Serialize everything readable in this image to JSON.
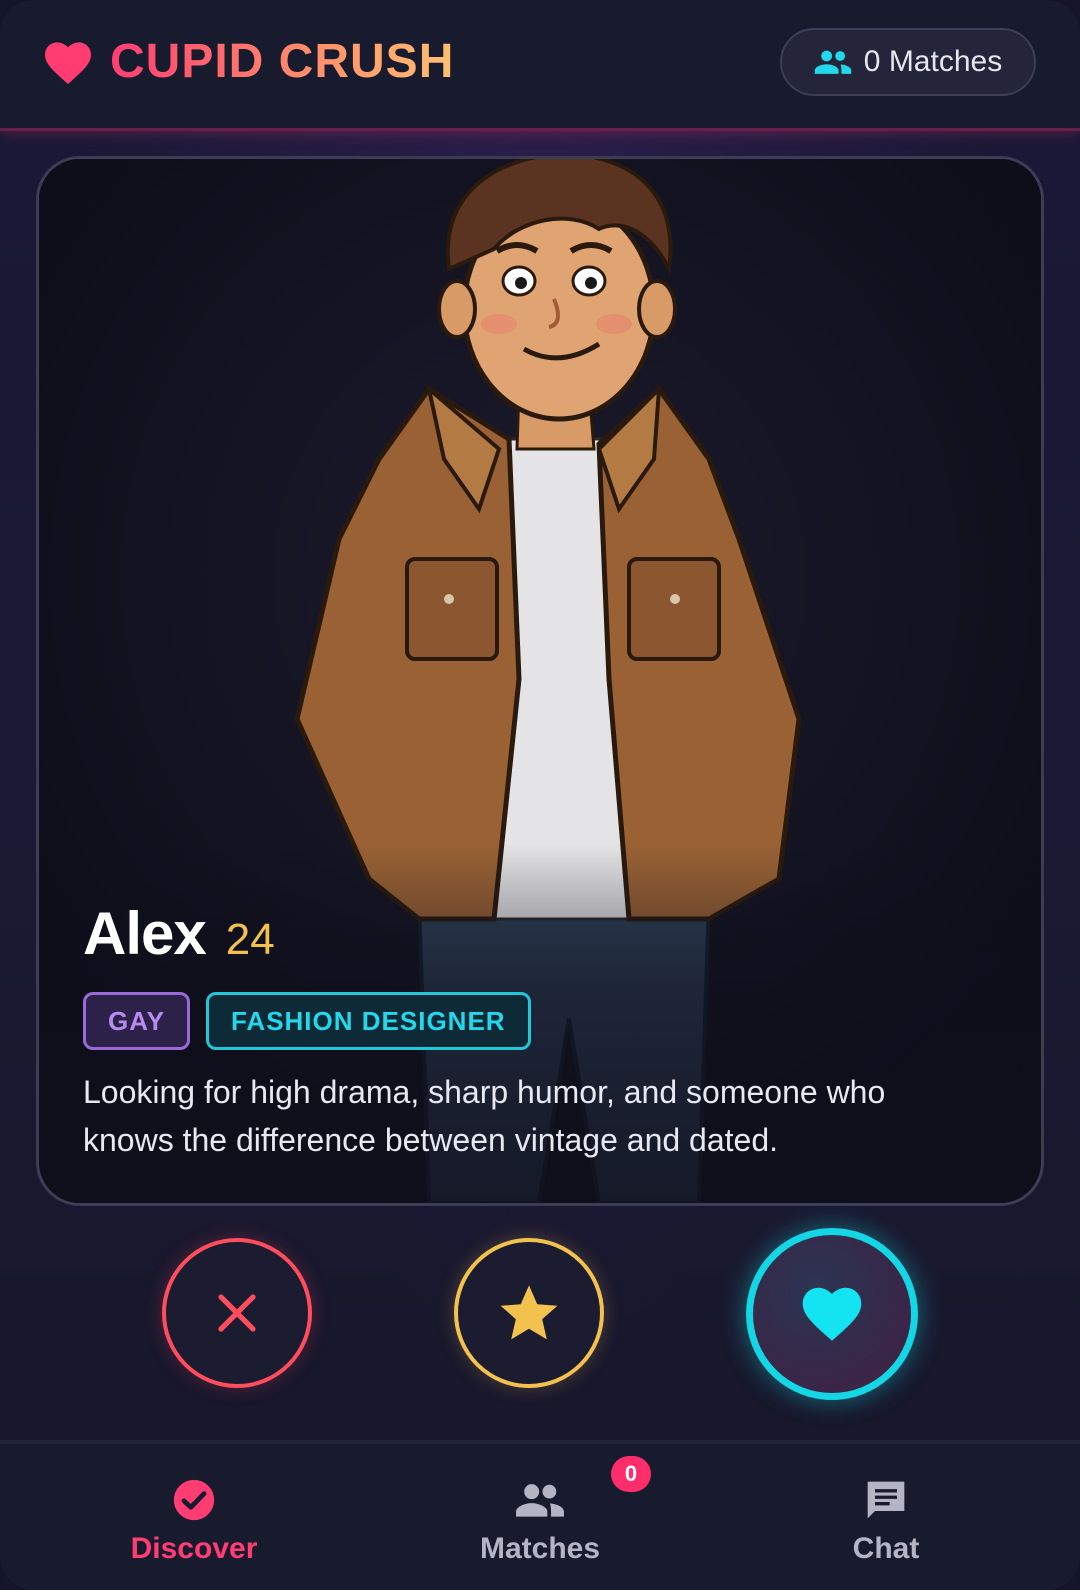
{
  "header": {
    "app_title": "CUPID CRUSH",
    "logo_icon": "heart-icon",
    "matches_pill": {
      "icon": "people-icon",
      "label": "0 Matches"
    }
  },
  "profile": {
    "name": "Alex",
    "age": "24",
    "tags": [
      {
        "label": "GAY",
        "color": "#b88af0"
      },
      {
        "label": "FASHION DESIGNER",
        "color": "#22d8ea"
      }
    ],
    "bio": "Looking for high drama, sharp humor, and someone who knows the difference between vintage and dated."
  },
  "actions": {
    "pass_icon": "close-icon",
    "superlike_icon": "star-icon",
    "like_icon": "heart-icon"
  },
  "nav": {
    "items": [
      {
        "label": "Discover",
        "icon": "check-circle-icon",
        "active": true
      },
      {
        "label": "Matches",
        "icon": "people-icon",
        "badge": "0"
      },
      {
        "label": "Chat",
        "icon": "chat-icon"
      }
    ]
  },
  "colors": {
    "accent_pink": "#ff3d72",
    "accent_cyan": "#14d6e4",
    "accent_gold": "#f2c14e",
    "pass_red": "#ff4d5e",
    "background": "#1a1836"
  }
}
